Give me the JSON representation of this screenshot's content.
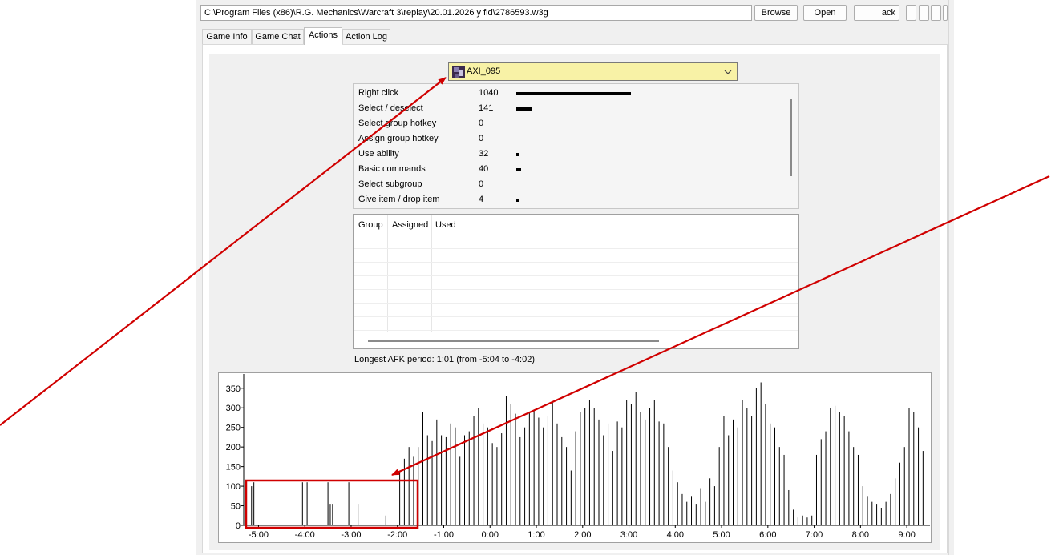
{
  "toolbar": {
    "path": "C:\\Program Files (x86)\\R.G. Mechanics\\Warcraft 3\\replay\\20.01.2026 y fid\\2786593.w3g",
    "browse_label": "Browse",
    "open_label": "Open",
    "back_label": "ack"
  },
  "tabs": [
    {
      "label": "Game Info"
    },
    {
      "label": "Game Chat"
    },
    {
      "label": "Actions"
    },
    {
      "label": "Action Log"
    }
  ],
  "active_tab": "Actions",
  "player": {
    "name": "AXI_095"
  },
  "stats": [
    {
      "label": "Right click",
      "value": "1040",
      "bar": 1040
    },
    {
      "label": "Select / deselect",
      "value": "141",
      "bar": 141
    },
    {
      "label": "Select group hotkey",
      "value": "0",
      "bar": 0
    },
    {
      "label": "Assign group hotkey",
      "value": "0",
      "bar": 0
    },
    {
      "label": "Use ability",
      "value": "32",
      "bar": 32
    },
    {
      "label": "Basic commands",
      "value": "40",
      "bar": 40
    },
    {
      "label": "Select subgroup",
      "value": "0",
      "bar": 0
    },
    {
      "label": "Give item / drop item",
      "value": "4",
      "bar": 4
    }
  ],
  "groups_table": {
    "columns": [
      "Group",
      "Assigned",
      "Used"
    ],
    "rows": []
  },
  "afk_text": "Longest AFK period: 1:01 (from -5:04 to -4:02)",
  "colors": {
    "combo_highlight": "#f8f2a6",
    "annotation_red": "#d00000",
    "bars": "#000000"
  },
  "icons": [
    "player-portrait-icon",
    "chevron-down-icon"
  ],
  "chart_data": {
    "type": "bar",
    "title": "",
    "xlabel": "",
    "ylabel": "",
    "xlim": [
      -5.25,
      9.5
    ],
    "ylim": [
      0,
      370
    ],
    "y_ticks": [
      0,
      50,
      100,
      150,
      200,
      250,
      300,
      350
    ],
    "x_ticks": [
      {
        "label": "-5:00",
        "value": -5
      },
      {
        "label": "-4:00",
        "value": -4
      },
      {
        "label": "-3:00",
        "value": -3
      },
      {
        "label": "-2:00",
        "value": -2
      },
      {
        "label": "-1:00",
        "value": -1
      },
      {
        "label": "0:00",
        "value": 0
      },
      {
        "label": "1:00",
        "value": 1
      },
      {
        "label": "2:00",
        "value": 2
      },
      {
        "label": "3:00",
        "value": 3
      },
      {
        "label": "4:00",
        "value": 4
      },
      {
        "label": "5:00",
        "value": 5
      },
      {
        "label": "6:00",
        "value": 6
      },
      {
        "label": "7:00",
        "value": 7
      },
      {
        "label": "8:00",
        "value": 8
      },
      {
        "label": "9:00",
        "value": 9
      }
    ],
    "x": [
      -5.15,
      -5.1,
      -4.05,
      -3.95,
      -3.5,
      -3.45,
      -3.4,
      -3.05,
      -2.85,
      -2.25,
      -1.95,
      -1.85,
      -1.75,
      -1.65,
      -1.55,
      -1.45,
      -1.35,
      -1.25,
      -1.15,
      -1.05,
      -0.95,
      -0.85,
      -0.75,
      -0.65,
      -0.55,
      -0.45,
      -0.35,
      -0.25,
      -0.15,
      -0.05,
      0.05,
      0.15,
      0.25,
      0.35,
      0.45,
      0.55,
      0.65,
      0.75,
      0.85,
      0.95,
      1.05,
      1.15,
      1.25,
      1.35,
      1.45,
      1.55,
      1.65,
      1.75,
      1.85,
      1.95,
      2.05,
      2.15,
      2.25,
      2.35,
      2.45,
      2.55,
      2.65,
      2.75,
      2.85,
      2.95,
      3.05,
      3.15,
      3.25,
      3.35,
      3.45,
      3.55,
      3.65,
      3.75,
      3.85,
      3.95,
      4.05,
      4.15,
      4.25,
      4.35,
      4.45,
      4.55,
      4.65,
      4.75,
      4.85,
      4.95,
      5.05,
      5.15,
      5.25,
      5.35,
      5.45,
      5.55,
      5.65,
      5.75,
      5.85,
      5.95,
      6.05,
      6.15,
      6.25,
      6.35,
      6.45,
      6.55,
      6.65,
      6.75,
      6.85,
      6.95,
      7.05,
      7.15,
      7.25,
      7.35,
      7.45,
      7.55,
      7.65,
      7.75,
      7.85,
      7.95,
      8.05,
      8.15,
      8.25,
      8.35,
      8.45,
      8.55,
      8.65,
      8.75,
      8.85,
      8.95,
      9.05,
      9.15,
      9.25,
      9.35
    ],
    "values": [
      100,
      110,
      110,
      110,
      110,
      55,
      55,
      110,
      55,
      25,
      140,
      170,
      200,
      175,
      200,
      290,
      230,
      215,
      270,
      230,
      225,
      260,
      250,
      175,
      230,
      240,
      280,
      300,
      260,
      250,
      210,
      200,
      235,
      330,
      310,
      285,
      225,
      250,
      290,
      295,
      275,
      250,
      280,
      315,
      260,
      225,
      200,
      140,
      240,
      290,
      300,
      320,
      300,
      270,
      230,
      260,
      190,
      265,
      250,
      320,
      310,
      340,
      290,
      270,
      300,
      320,
      265,
      260,
      200,
      140,
      110,
      80,
      60,
      75,
      55,
      95,
      60,
      120,
      100,
      200,
      280,
      230,
      270,
      250,
      320,
      300,
      280,
      350,
      365,
      310,
      260,
      250,
      200,
      180,
      90,
      40,
      20,
      25,
      20,
      25,
      180,
      220,
      240,
      300,
      305,
      290,
      280,
      240,
      200,
      180,
      100,
      75,
      60,
      55,
      45,
      60,
      80,
      120,
      160,
      200,
      300,
      290,
      250,
      190
    ]
  }
}
